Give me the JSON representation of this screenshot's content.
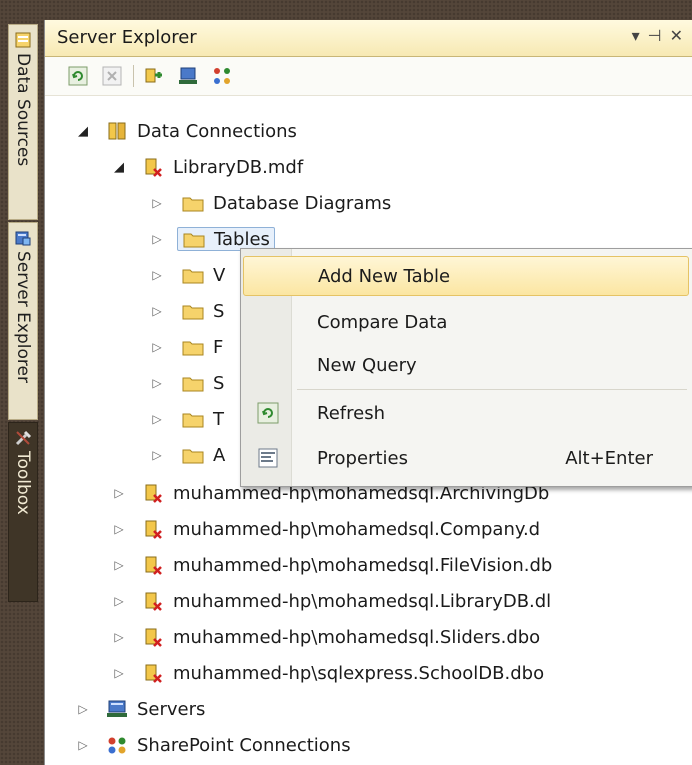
{
  "side_tabs": [
    {
      "label": "Data Sources",
      "icon": "data-sources-icon"
    },
    {
      "label": "Server Explorer",
      "icon": "server-explorer-icon"
    },
    {
      "label": "Toolbox",
      "icon": "toolbox-icon"
    }
  ],
  "panel": {
    "title": "Server Explorer",
    "controls": {
      "dropdown": "▾",
      "pin": "⊣",
      "close": "✕"
    }
  },
  "toolbar": {
    "buttons": [
      "refresh-icon",
      "stop-icon",
      "connect-database-icon",
      "connect-server-icon",
      "connect-sharepoint-icon"
    ]
  },
  "tree": {
    "root": "Data Connections",
    "db": "LibraryDB.mdf",
    "folders": [
      "Database Diagrams",
      "Tables",
      "V",
      "S",
      "F",
      "S",
      "T",
      "A"
    ],
    "connections": [
      "muhammed-hp\\mohamedsql.ArchivingDb",
      "muhammed-hp\\mohamedsql.Company.d",
      "muhammed-hp\\mohamedsql.FileVision.db",
      "muhammed-hp\\mohamedsql.LibraryDB.dl",
      "muhammed-hp\\mohamedsql.Sliders.dbo",
      "muhammed-hp\\sqlexpress.SchoolDB.dbo"
    ],
    "servers": "Servers",
    "sharepoint": "SharePoint Connections"
  },
  "context_menu": {
    "items": [
      {
        "label": "Add New Table",
        "shortcut": ""
      },
      {
        "label": "Compare Data",
        "shortcut": ""
      },
      {
        "label": "New Query",
        "shortcut": ""
      },
      {
        "label": "Refresh",
        "shortcut": ""
      },
      {
        "label": "Properties",
        "shortcut": "Alt+Enter"
      }
    ]
  },
  "colors": {
    "accent": "#f7e9b3",
    "selection": "#e7f0fb",
    "menu_highlight": "#fbe6a2",
    "background": "#54463a"
  }
}
